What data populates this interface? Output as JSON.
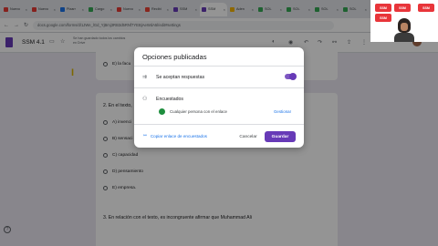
{
  "browser": {
    "tabs": [
      {
        "label": "Nuevo",
        "color": "#e53935"
      },
      {
        "label": "Nuevo",
        "color": "#e53935"
      },
      {
        "label": "Pizarr",
        "color": "#1a73e8"
      },
      {
        "label": "Cargo",
        "color": "#34a853"
      },
      {
        "label": "Nuevo",
        "color": "#e53935"
      },
      {
        "label": "Recibi",
        "color": "#ea4335"
      },
      {
        "label": "SSM",
        "color": "#673ab7"
      },
      {
        "label": "SSM",
        "color": "#673ab7",
        "active": true
      },
      {
        "label": "Aden",
        "color": "#f4b400"
      },
      {
        "label": "SOL",
        "color": "#34a853"
      },
      {
        "label": "SOL",
        "color": "#34a853"
      },
      {
        "label": "SOL",
        "color": "#34a853"
      },
      {
        "label": "SOL",
        "color": "#34a853"
      }
    ],
    "url": "docs.google.com/forms/d/1JWe_lGd_YjBmj3RB3d5RNf7YEBjAeWdA5l/edit#settings"
  },
  "forms_header": {
    "title": "SSM 4.1",
    "autosave": "Se han guardado todos los cambios en Drive"
  },
  "questions": {
    "q1_option": "E) la facu",
    "q2_title": "2. En el texto,",
    "q2_options": [
      "A) invenci",
      "B) sensaci",
      "C) capacidad",
      "D) pensamiento",
      "E) empresa."
    ],
    "q3_title": "3. En relación con el texto, es incongruente afirmar que Muhammad Ali"
  },
  "dialog": {
    "title": "Opciones publicadas",
    "accepting_label": "Se aceptan respuestas",
    "accepting_on": true,
    "respondents_label": "Encuestados",
    "audience_label": "Cualquier persona con el enlace",
    "manage_label": "Gestionar",
    "copy_link_label": "Copiar enlace de encuestados",
    "cancel_label": "Cancelar",
    "save_label": "Guardar"
  },
  "webcam": {
    "stickers": [
      "SSM",
      "SSM",
      "SSM",
      "SSM"
    ]
  },
  "colors": {
    "accent": "#673ab7",
    "link": "#1a73e8"
  }
}
